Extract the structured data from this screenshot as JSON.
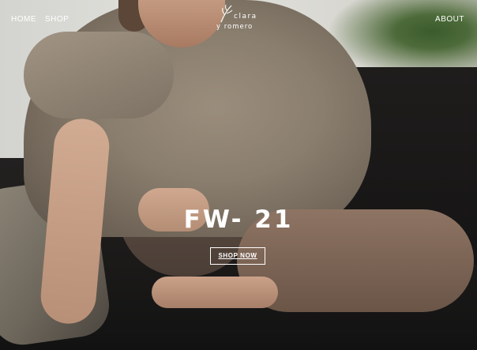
{
  "nav": {
    "home_label": "HOME",
    "shop_label": "SHOP",
    "about_label": "ABOUT"
  },
  "logo": {
    "line1": "clara",
    "line2": "y romero",
    "icon": "leaf-icon"
  },
  "hero": {
    "headline": "FW- 21",
    "cta_label": "SHOP NOW"
  }
}
